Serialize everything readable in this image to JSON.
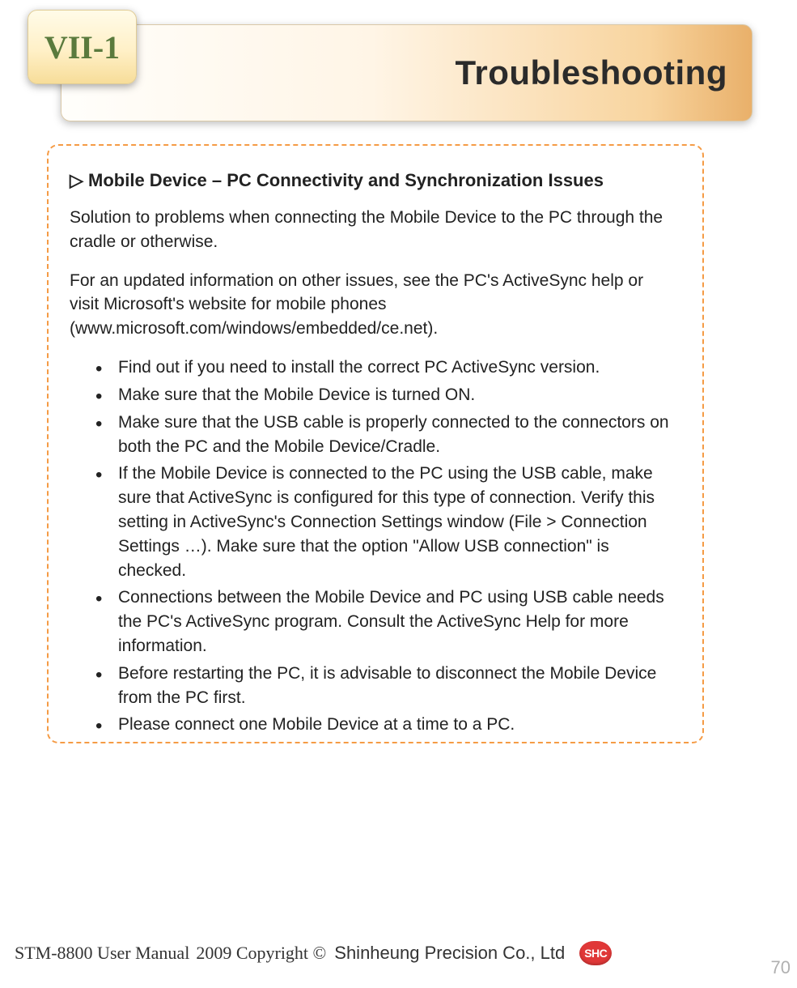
{
  "header": {
    "tab_label": "VII-1",
    "title": "Troubleshooting"
  },
  "section": {
    "heading": "▷ Mobile Device – PC Connectivity and Synchronization Issues",
    "intro_1": "Solution to problems when connecting the Mobile Device to the PC through the cradle or otherwise.",
    "intro_2": "For an updated information on other issues, see the PC's ActiveSync help or visit Microsoft's website for mobile phones (www.microsoft.com/windows/embedded/ce.net).",
    "bullets": [
      "Find out if you need to install the correct PC ActiveSync version.",
      "Make sure that the Mobile Device is turned ON.",
      "Make sure that the USB cable is properly connected to the connectors on both the PC and the Mobile Device/Cradle.",
      "If the Mobile Device is connected to the PC using the USB cable, make sure that ActiveSync is configured for this type of connection. Verify this setting in ActiveSync's Connection Settings window (File > Connection Settings …). Make sure that the option \"Allow USB connection\" is checked.",
      "Connections between the Mobile Device and PC using USB cable needs the PC's ActiveSync program. Consult the ActiveSync Help for more information.",
      "Before restarting the PC, it is advisable to disconnect the Mobile Device from the PC first.",
      "Please connect one Mobile Device at a time to a PC."
    ]
  },
  "footer": {
    "manual": "STM-8800 User Manual",
    "copyright": "2009 Copyright ©",
    "company": "Shinheung Precision Co., Ltd",
    "logo_text": "SHC",
    "page_number": "70"
  }
}
